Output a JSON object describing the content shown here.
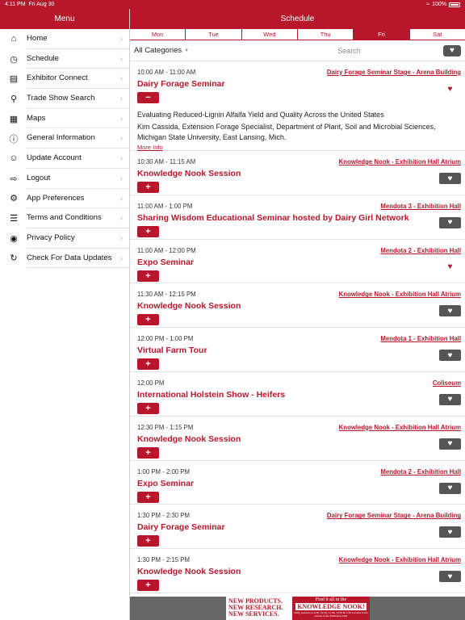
{
  "status": {
    "time": "4:11 PM",
    "date": "Fri Aug 30",
    "battery": "100%"
  },
  "sidebar": {
    "title": "Menu",
    "items": [
      {
        "label": "Home",
        "icon": "home-icon"
      },
      {
        "label": "Schedule",
        "icon": "clock-icon"
      },
      {
        "label": "Exhibitor Connect",
        "icon": "barcode-icon"
      },
      {
        "label": "Trade Show Search",
        "icon": "search-icon"
      },
      {
        "label": "Maps",
        "icon": "map-icon"
      },
      {
        "label": "General Information",
        "icon": "info-icon"
      },
      {
        "label": "Update Account",
        "icon": "account-icon"
      },
      {
        "label": "Logout",
        "icon": "logout-icon"
      },
      {
        "label": "App Preferences",
        "icon": "gear-icon"
      },
      {
        "label": "Terms and Conditions",
        "icon": "list-icon"
      },
      {
        "label": "Privacy Policy",
        "icon": "eye-icon"
      },
      {
        "label": "Check For Data Updates",
        "icon": "refresh-icon"
      }
    ]
  },
  "main": {
    "title": "Schedule",
    "days": [
      "Mon",
      "Tue",
      "Wed",
      "Thu",
      "Fri",
      "Sat"
    ],
    "active_day": "Fri",
    "category": "All Categories",
    "search_placeholder": "Search"
  },
  "events": [
    {
      "time": "10:00 AM - 11:00 AM",
      "location": "Dairy Forage Seminar Stage - Arena Building",
      "title": "Dairy Forage Seminar",
      "favorite": true,
      "expanded": true,
      "description": "Evaluating Reduced-Lignin Alfalfa Yield and Quality Across the United States",
      "speakers": "Kim Cassida, Extension Forage Specialist, Department of Plant, Soil and Microbial Sciences, Michigan State University, East Lansing, Mich.",
      "more": "More Info",
      "button": "−"
    },
    {
      "time": "10:30 AM - 11:15 AM",
      "location": "Knowledge Nook - Exhibition Hall Atrium",
      "title": "Knowledge Nook Session",
      "favorite": false,
      "button": "+"
    },
    {
      "time": "11:00 AM - 1:00 PM",
      "location": "Mendota 3 - Exhibition Hall",
      "title": "Sharing Wisdom Educational Seminar hosted by Dairy Girl Network",
      "favorite": false,
      "button": "+"
    },
    {
      "time": "11:00 AM - 12:00 PM",
      "location": "Mendota 2 - Exhibition Hall",
      "title": "Expo Seminar",
      "favorite": true,
      "button": "+"
    },
    {
      "time": "11:30 AM - 12:15 PM",
      "location": "Knowledge Nook - Exhibition Hall Atrium",
      "title": "Knowledge Nook Session",
      "favorite": false,
      "button": "+"
    },
    {
      "time": "12:00 PM - 1:00 PM",
      "location": "Mendota 1 - Exhibition Hall",
      "title": "Virtual Farm Tour",
      "favorite": false,
      "button": "+"
    },
    {
      "time": "12:00 PM",
      "location": "Coliseum",
      "title": "International Holstein Show - Heifers",
      "favorite": false,
      "button": "+"
    },
    {
      "time": "12:30 PM - 1:15 PM",
      "location": "Knowledge Nook - Exhibition Hall Atrium",
      "title": "Knowledge Nook Session",
      "favorite": false,
      "button": "+"
    },
    {
      "time": "1:00 PM - 2:00 PM",
      "location": "Mendota 2 - Exhibition Hall",
      "title": "Expo Seminar",
      "favorite": false,
      "button": "+"
    },
    {
      "time": "1:30 PM - 2:30 PM",
      "location": "Dairy Forage Seminar Stage - Arena Building",
      "title": "Dairy Forage Seminar",
      "favorite": false,
      "button": "+"
    },
    {
      "time": "1:30 PM - 2:15 PM",
      "location": "Knowledge Nook - Exhibition Hall Atrium",
      "title": "Knowledge Nook Session",
      "favorite": false,
      "button": "+"
    }
  ],
  "banner": {
    "left": [
      "NEW PRODUCTS.",
      "NEW RESEARCH.",
      "NEW SERVICES."
    ],
    "right_line1": "Find it all in the",
    "right_line2": "KNOWLEDGE NOOK!",
    "right_line3": "Daily sessions at 9:30, 10:30, 11:30, 12:30 & 1:30 Located in the atrium of the Exhibition Hall"
  },
  "colors": {
    "brand": "#b8172b",
    "dark_button": "#555555"
  }
}
